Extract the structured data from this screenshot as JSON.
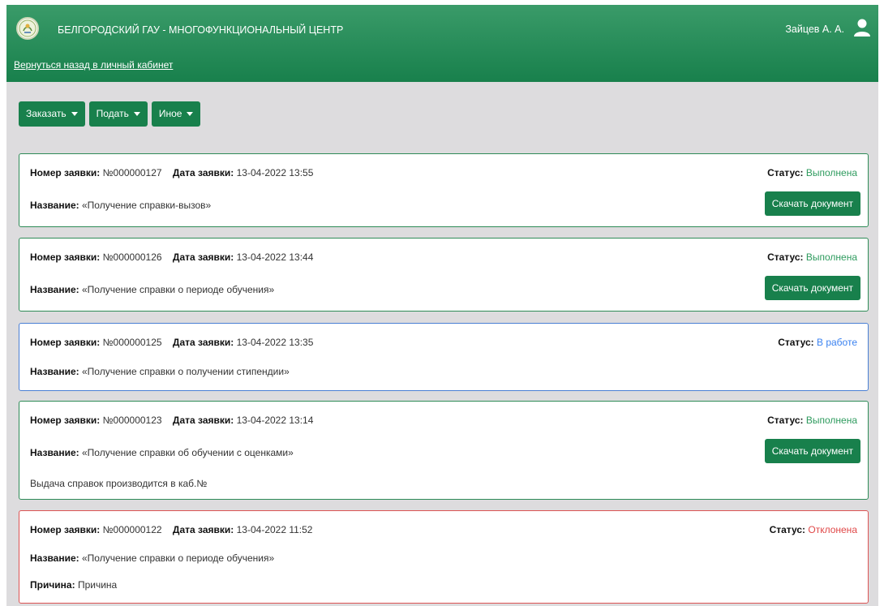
{
  "header": {
    "brand": "БЕЛГОРОДСКИЙ ГАУ - МНОГОФУНКЦИОНАЛЬНЫЙ ЦЕНТР",
    "back_link": "Вернуться назад в личный кабинет",
    "user_name": "Зайцев А. А.",
    "logo_icon": "university-logo-icon",
    "user_icon": "user-icon"
  },
  "toolbar": {
    "order": "Заказать",
    "submit": "Подать",
    "other": "Иное"
  },
  "labels": {
    "number": "Номер заявки:",
    "date": "Дата заявки:",
    "status": "Статус:",
    "title": "Название:",
    "reason": "Причина:",
    "download": "Скачать документ"
  },
  "colors": {
    "brand_green": "#18804c",
    "status_done": "#2e9b5e",
    "status_work": "#3b82f0",
    "status_rejected": "#e04848"
  },
  "requests": [
    {
      "number": "№000000127",
      "date": "13-04-2022 13:55",
      "status": "Выполнена",
      "title": "«Получение справки-вызов»"
    },
    {
      "number": "№000000126",
      "date": "13-04-2022 13:44",
      "status": "Выполнена",
      "title": "«Получение справки о периоде обучения»"
    },
    {
      "number": "№000000125",
      "date": "13-04-2022 13:35",
      "status": "В работе",
      "title": "«Получение справки о получении стипендии»"
    },
    {
      "number": "№000000123",
      "date": "13-04-2022 13:14",
      "status": "Выполнена",
      "title": "«Получение справки об обучении с оценками»",
      "note": "Выдача справок производится в каб.№"
    },
    {
      "number": "№000000122",
      "date": "13-04-2022 11:52",
      "status": "Отклонена",
      "title": "«Получение справки о периоде обучения»",
      "reason": "Причина"
    }
  ]
}
